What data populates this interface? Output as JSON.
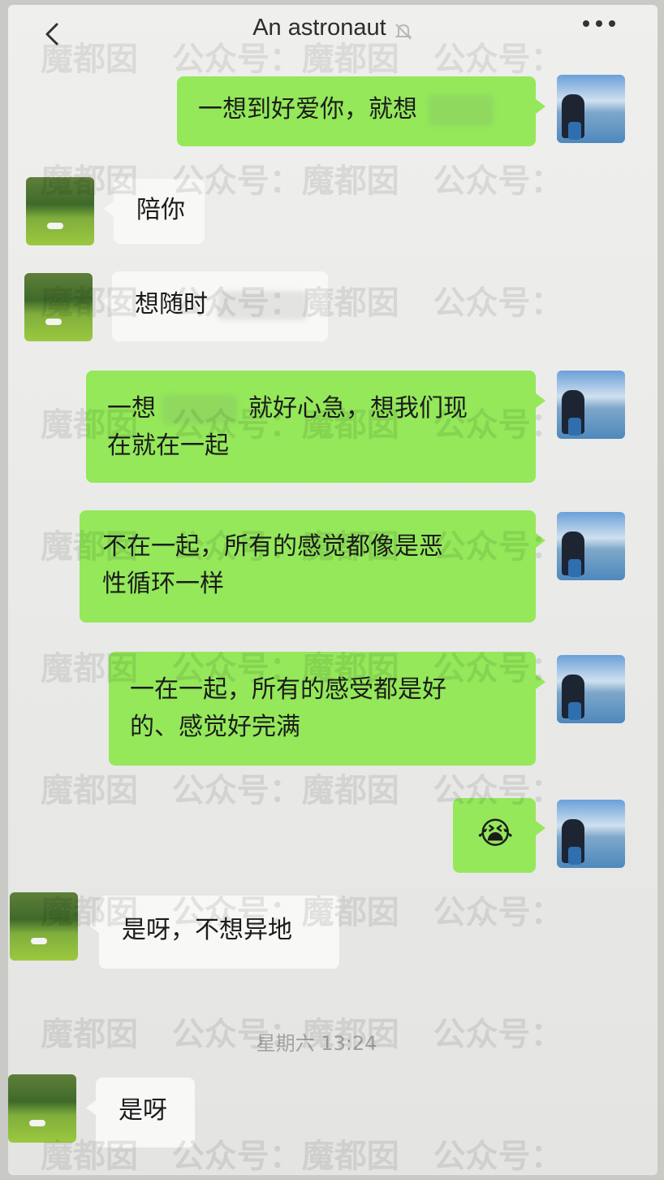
{
  "header": {
    "title": "An astronaut",
    "back_icon": "chevron-left-icon",
    "mute_icon": "bell-mute-icon",
    "more_icon": "ellipsis-icon"
  },
  "messages": [
    {
      "side": "out",
      "text": "一想到好爱你，就想"
    },
    {
      "side": "in",
      "text": "陪你"
    },
    {
      "side": "in",
      "text": "想随时"
    },
    {
      "side": "out",
      "text_a": "一想",
      "text_b": "就好心急，想我们现",
      "text_c": "在就在一起"
    },
    {
      "side": "out",
      "text": "不在一起，所有的感觉都像是恶",
      "text2": "性循环一样"
    },
    {
      "side": "out",
      "text": "一在一起，所有的感受都是好",
      "text2": "的、感觉好完满"
    },
    {
      "side": "out",
      "emoji": "😭"
    },
    {
      "side": "in",
      "text": "是呀，不想异地"
    },
    {
      "side": "in",
      "text": "是呀"
    }
  ],
  "timestamp": "星期六 13:24",
  "watermark": "魔都囡   公众号：魔都囡   公众号：",
  "colors": {
    "outgoing_bubble": "#94e85a",
    "incoming_bubble": "#f8f8f6",
    "background": "#efefed"
  }
}
